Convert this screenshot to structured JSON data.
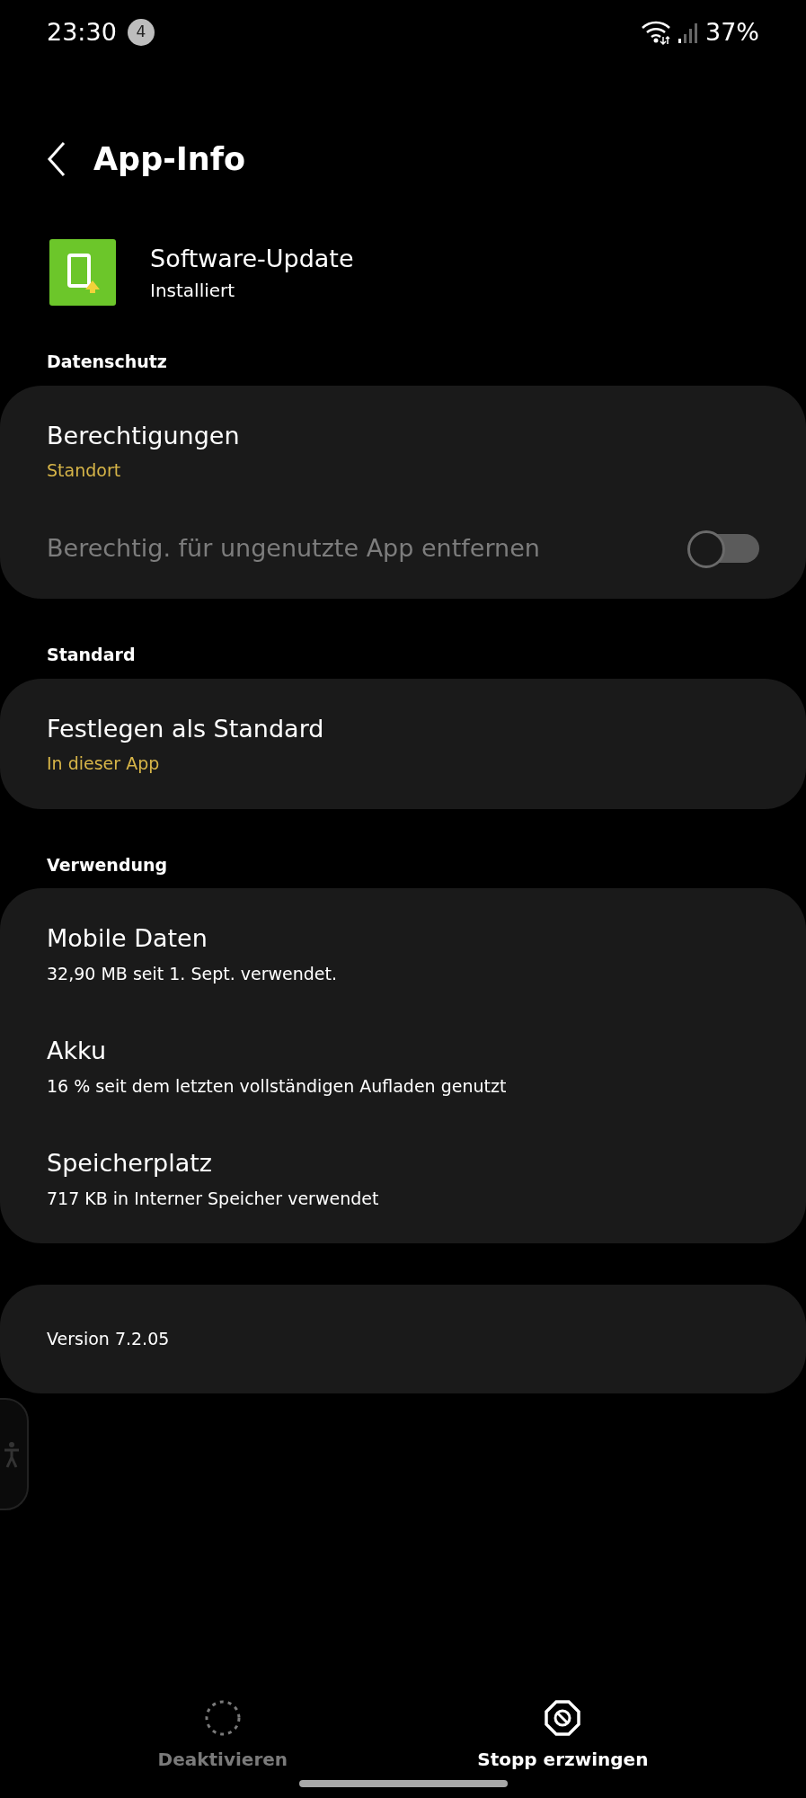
{
  "status_bar": {
    "time": "23:30",
    "notification_count": "4",
    "battery": "37%"
  },
  "header": {
    "title": "App-Info"
  },
  "app": {
    "name": "Software-Update",
    "status": "Installiert"
  },
  "sections": [
    {
      "title": "Datenschutz",
      "items": [
        {
          "kind": "link",
          "title": "Berechtigungen",
          "subtitle": "Standort",
          "accent": true
        },
        {
          "kind": "toggle",
          "title": "Berechtig. für ungenutzte App entfernen",
          "on": false,
          "disabled": true
        }
      ]
    },
    {
      "title": "Standard",
      "items": [
        {
          "kind": "link",
          "title": "Festlegen als Standard",
          "subtitle": "In dieser App",
          "accent": true
        }
      ]
    },
    {
      "title": "Verwendung",
      "items": [
        {
          "kind": "link",
          "title": "Mobile Daten",
          "subtitle": "32,90 MB seit 1. Sept. verwendet.",
          "accent": false
        },
        {
          "kind": "link",
          "title": "Akku",
          "subtitle": "16 % seit dem letzten vollständigen Aufladen genutzt",
          "accent": false
        },
        {
          "kind": "link",
          "title": "Speicherplatz",
          "subtitle": "717 KB in Interner Speicher verwendet",
          "accent": false
        }
      ]
    }
  ],
  "version": {
    "text": "Version 7.2.05"
  },
  "bottom_actions": [
    {
      "kind": "deactivate",
      "label": "Deaktivieren",
      "disabled": true
    },
    {
      "kind": "stop",
      "label": "Stopp erzwingen",
      "disabled": false
    }
  ]
}
